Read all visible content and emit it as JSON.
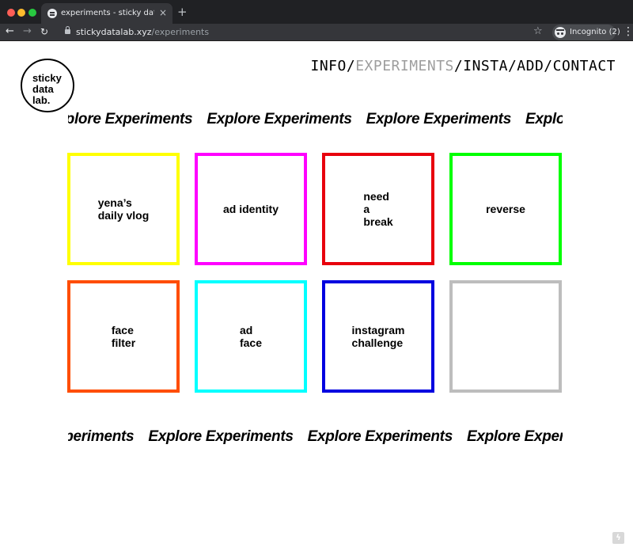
{
  "browser": {
    "tab_title": "experiments - sticky data lab",
    "tab_close": "×",
    "new_tab": "+",
    "url_domain": "stickydatalab.xyz",
    "url_path": "/experiments",
    "incognito_label": "Incognito (2)",
    "icons": {
      "back": "←",
      "forward": "→",
      "reload": "↻",
      "star": "☆",
      "menu": "⋮"
    }
  },
  "logo": {
    "lines": [
      "sticky",
      "data",
      "lab."
    ]
  },
  "nav": {
    "items": [
      {
        "label": "INFO",
        "active": false
      },
      {
        "label": "EXPERIMENTS",
        "active": true
      },
      {
        "label": "INSTA",
        "active": false
      },
      {
        "label": "ADD",
        "active": false
      },
      {
        "label": "CONTACT",
        "active": false
      }
    ],
    "separator": "/",
    "active_color": "#9e9e9e"
  },
  "marquee": {
    "text": "Explore Experiments"
  },
  "experiments": [
    {
      "label": "yena’s\ndaily vlog",
      "color": "#ffff00"
    },
    {
      "label": "ad identity",
      "color": "#ff00ff"
    },
    {
      "label": "need\na\nbreak",
      "color": "#e8000d"
    },
    {
      "label": "reverse",
      "color": "#00ff00"
    },
    {
      "label": "face\nfilter",
      "color": "#ff4d00"
    },
    {
      "label": "ad\nface",
      "color": "#00ffff"
    },
    {
      "label": "instagram\nchallenge",
      "color": "#0000e0"
    },
    {
      "label": "",
      "color": "#bdbdbd"
    }
  ],
  "corner_icon": "ϟ"
}
